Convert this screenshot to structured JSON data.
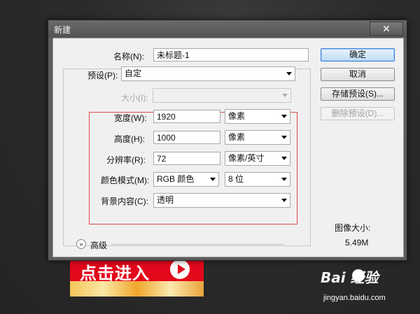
{
  "window": {
    "title": "新建",
    "close": "✕"
  },
  "name": {
    "label": "名称(N):",
    "value": "未标题-1"
  },
  "preset": {
    "label": "预设(P):",
    "value": "自定"
  },
  "size": {
    "label": "大小(I):",
    "value": ""
  },
  "width": {
    "label": "宽度(W):",
    "value": "1920",
    "unit": "像素"
  },
  "height": {
    "label": "高度(H):",
    "value": "1000",
    "unit": "像素"
  },
  "resolution": {
    "label": "分辨率(R):",
    "value": "72",
    "unit": "像素/英寸"
  },
  "color_mode": {
    "label": "颜色模式(M):",
    "value": "RGB 颜色",
    "depth": "8 位"
  },
  "background": {
    "label": "背景内容(C):",
    "value": "透明"
  },
  "advanced": {
    "label": "高级",
    "icon": "double-chevron-down-icon"
  },
  "buttons": {
    "ok": "确定",
    "cancel": "取消",
    "save_preset": "存储预设(S)...",
    "delete_preset": "删除预设(D)..."
  },
  "image_size": {
    "title": "图像大小:",
    "value": "5.49M"
  },
  "promo": {
    "text": "点击进入",
    "icon": "play-icon",
    "color": "#e3081c"
  },
  "watermark": {
    "brand": "Bai  经验",
    "url": "jingyan.baidu.com",
    "icon": "paw-icon"
  },
  "colors": {
    "highlight_box": "#e04848",
    "default_button": "#3a7bd5"
  }
}
